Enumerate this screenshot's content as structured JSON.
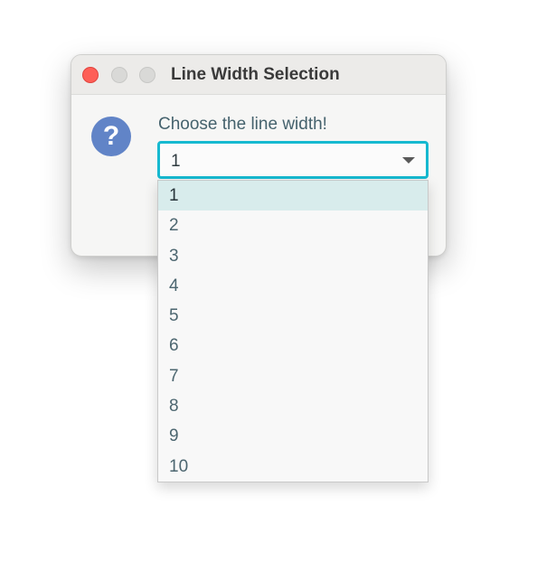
{
  "window": {
    "title": "Line Width Selection",
    "traffic_lights": [
      {
        "name": "close",
        "color": "#fe5f57"
      },
      {
        "name": "minimize",
        "color": "#d9d9d7"
      },
      {
        "name": "zoom",
        "color": "#d9d9d7"
      }
    ]
  },
  "dialog": {
    "icon": "question-mark-icon",
    "icon_glyph": "?",
    "icon_color": "#6184c7",
    "prompt": "Choose the line width!"
  },
  "combobox": {
    "selected_value": "1",
    "focus_color": "#16b9d0",
    "options": [
      "1",
      "2",
      "3",
      "4",
      "5",
      "6",
      "7",
      "8",
      "9",
      "10"
    ],
    "highlighted_index": 0
  }
}
